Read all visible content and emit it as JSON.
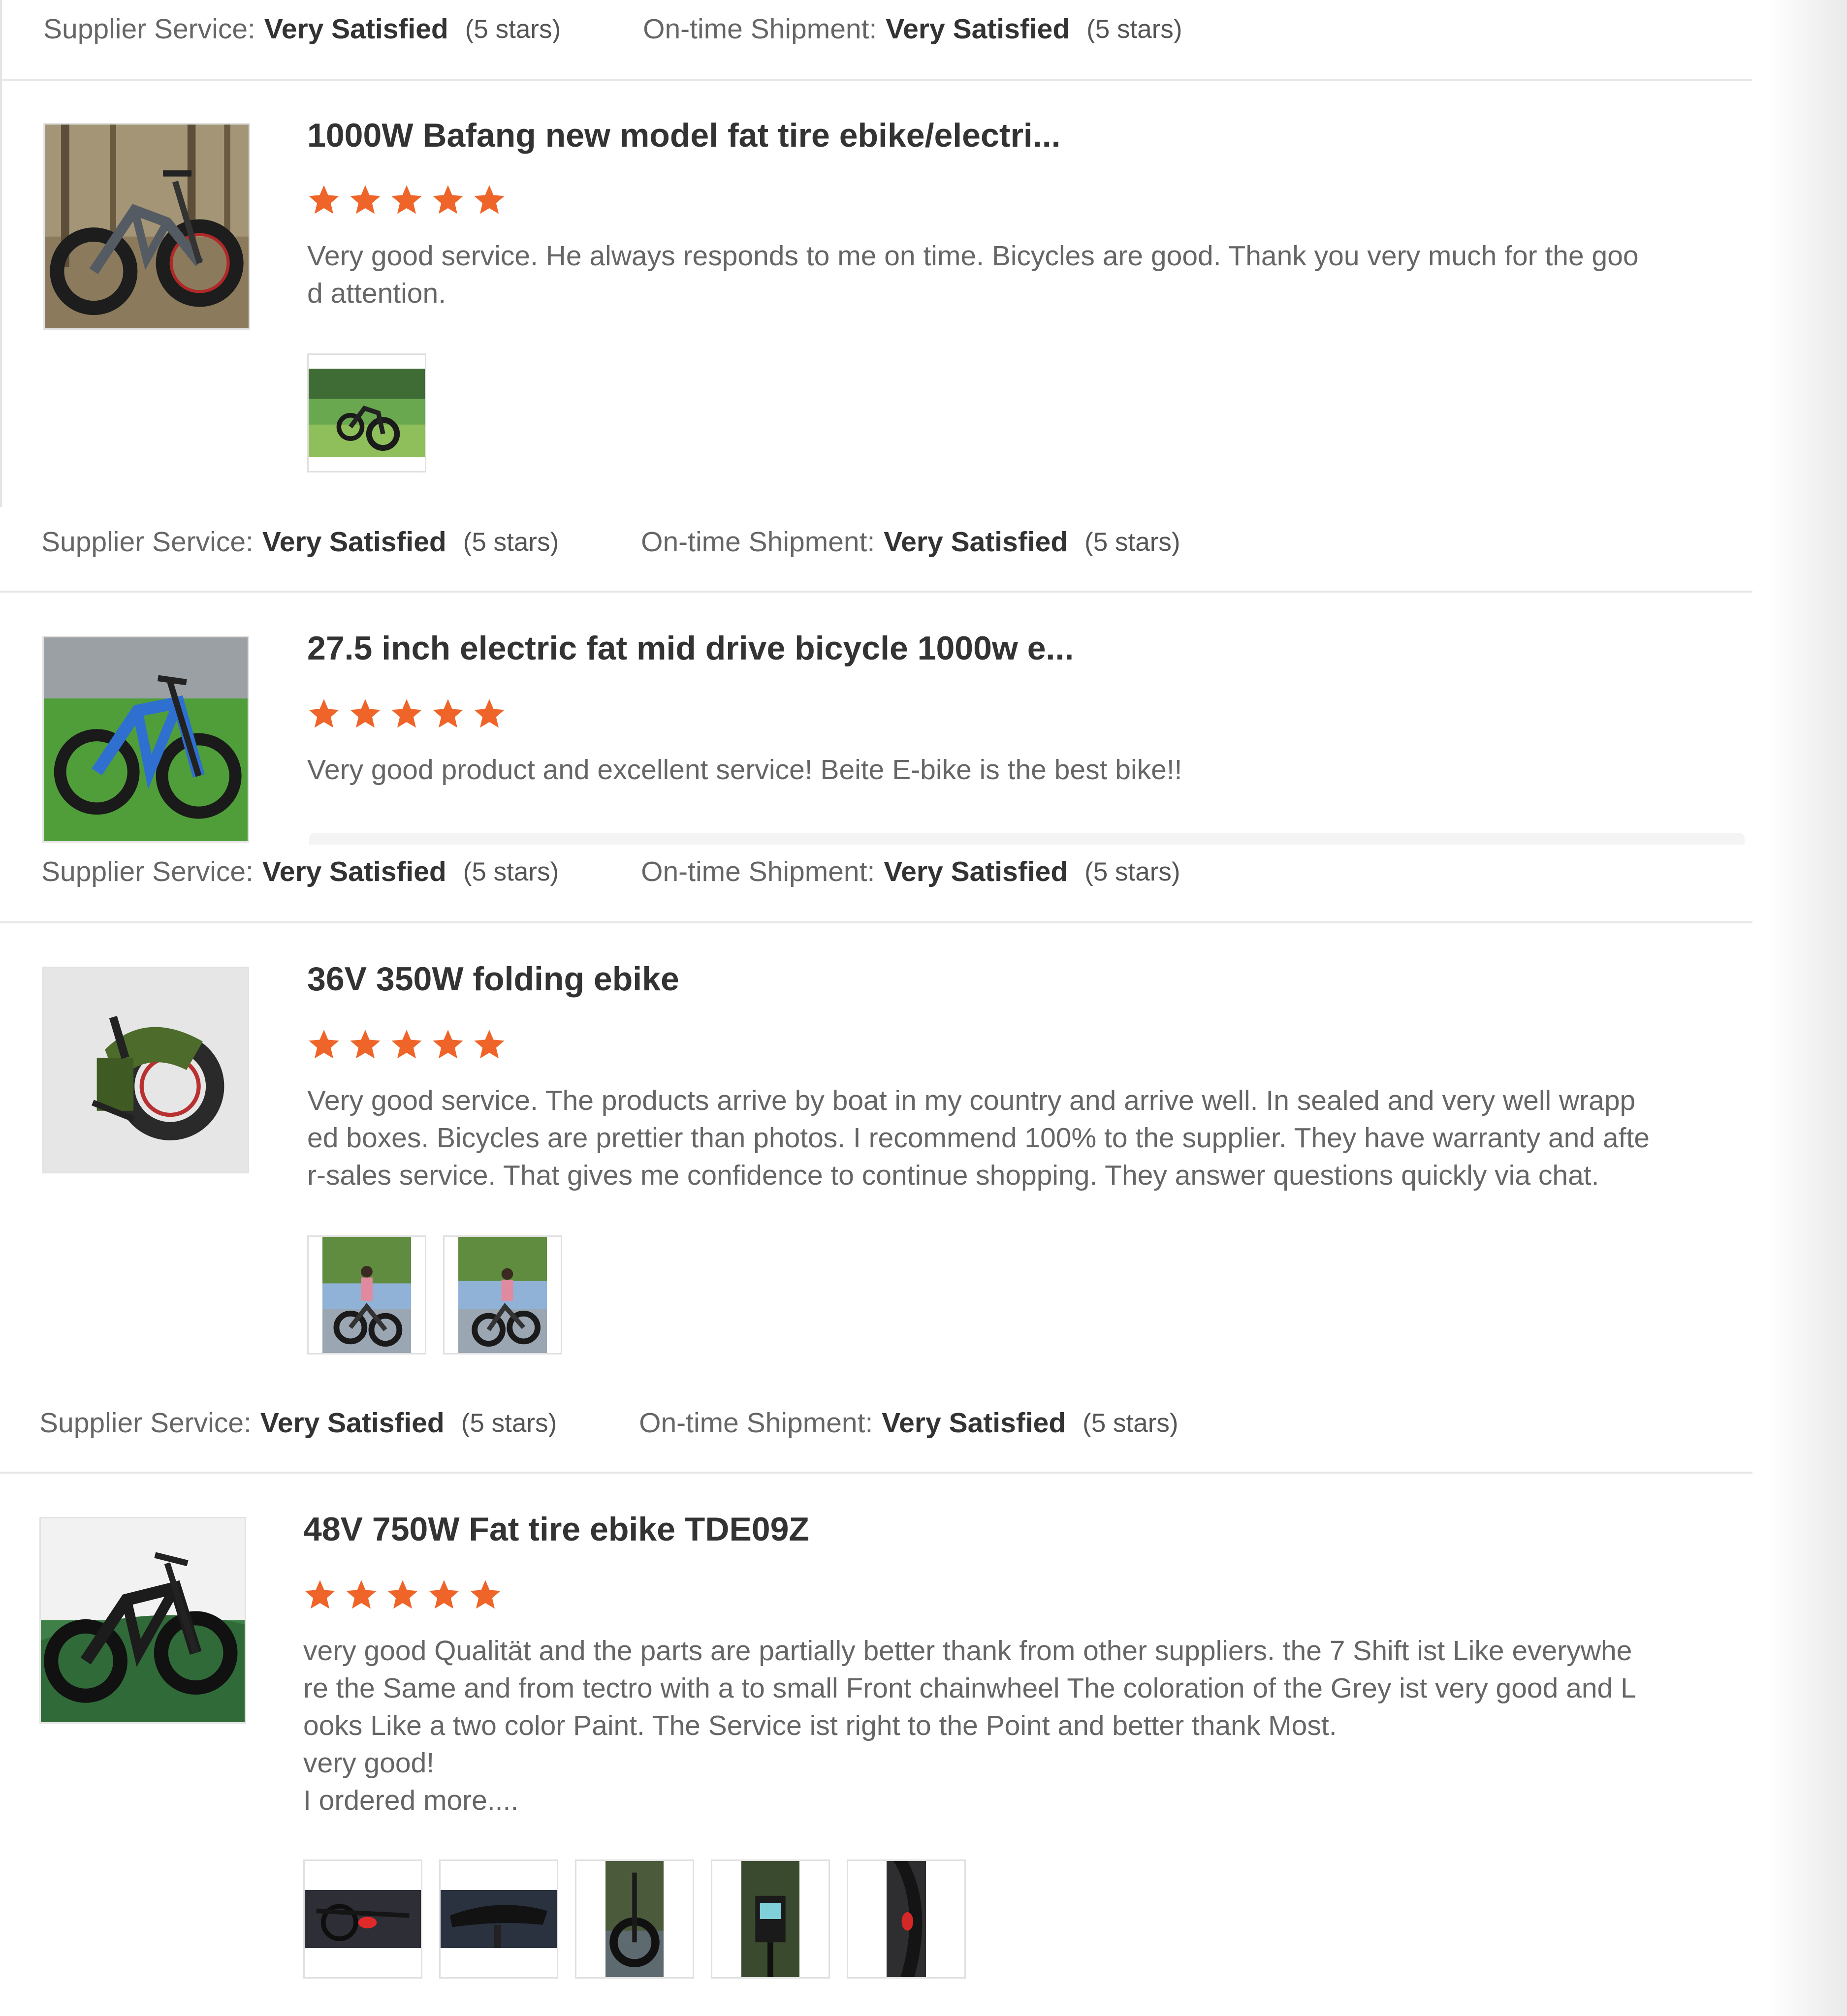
{
  "labels": {
    "supplier_service": "Supplier Service:",
    "ontime_shipment": "On-time Shipment:"
  },
  "colors": {
    "star": "#ef6428",
    "divider": "#e6e6e6",
    "text_muted": "#666666",
    "text_strong": "#333333"
  },
  "top_ratings": {
    "supplier_value": "Very Satisfied",
    "supplier_stars": "(5 stars)",
    "shipment_value": "Very Satisfied",
    "shipment_stars": "(5 stars)"
  },
  "reviews": [
    {
      "product_title": "1000W Bafang new model fat tire ebike/electri...",
      "rating": 5,
      "comment": "Very good service. He always responds to me on time. Bicycles are good. Thank you very much for the goo\nd attention.",
      "product_image_icon": "fat-tire-ebike-image",
      "photo_icons": [
        "ebike-on-grass-photo"
      ],
      "supplier_value": "Very Satisfied",
      "supplier_stars": "(5 stars)",
      "shipment_value": "Very Satisfied",
      "shipment_stars": "(5 stars)"
    },
    {
      "product_title": "27.5 inch electric fat mid drive bicycle 1000w e...",
      "rating": 5,
      "comment": "Very good product and excellent service! Beite E-bike is the best bike!!",
      "product_image_icon": "blue-ebike-image",
      "photo_icons": [],
      "supplier_value": "Very Satisfied",
      "supplier_stars": "(5 stars)",
      "shipment_value": "Very Satisfied",
      "shipment_stars": "(5 stars)"
    },
    {
      "product_title": "36V 350W folding ebike",
      "rating": 5,
      "comment": "Very good service. The products arrive by boat in my country and arrive well. In sealed and very well wrapp\ned boxes. Bicycles are prettier than photos. I recommend 100% to the supplier. They have warranty and afte\nr-sales service. That gives me confidence to continue shopping. They answer questions quickly via chat.",
      "product_image_icon": "folding-ebike-image",
      "photo_icons": [
        "rider-with-ebike-photo",
        "rider-with-ebike-photo"
      ],
      "supplier_value": "Very Satisfied",
      "supplier_stars": "(5 stars)",
      "shipment_value": "Very Satisfied",
      "shipment_stars": "(5 stars)"
    },
    {
      "product_title": "48V 750W Fat tire ebike TDE09Z",
      "rating": 5,
      "comment": "very good Qualität and the parts are partially better thank from other suppliers. the 7 Shift ist Like everywhe\nre the Same and from tectro with a to small Front chainwheel The coloration of the Grey ist very good and L\nooks Like a two color Paint. The Service ist right to the Point and better thank Most.\nvery good!\nI ordered more....",
      "product_image_icon": "black-fat-tire-ebike-image",
      "photo_icons": [
        "ebike-taillight-photo",
        "ebike-saddle-photo",
        "ebike-front-wheel-photo",
        "ebike-display-photo",
        "ebike-fender-photo"
      ]
    }
  ]
}
